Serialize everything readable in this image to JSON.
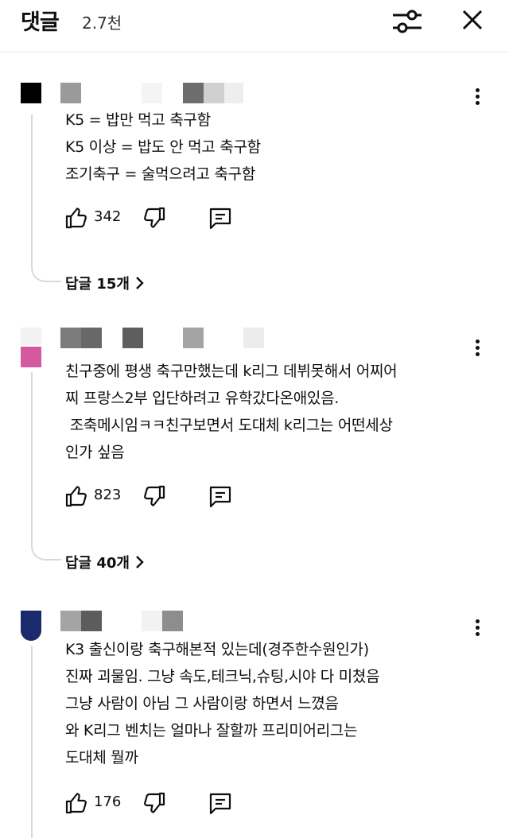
{
  "header": {
    "title": "댓글",
    "count": "2.7천",
    "filter_icon": "sliders-icon",
    "close_icon": "close-icon"
  },
  "comments": [
    {
      "avatar_color": "#000000",
      "lines": [
        "K5 = 밥만 먹고 축구함",
        "K5 이상 = 밥도 안 먹고 축구함",
        "조기축구 = 술먹으려고 축구함"
      ],
      "likes": "342",
      "replies": "답글 15개"
    },
    {
      "avatar_color": "#d4599f",
      "lines": [
        "친구중에 평생 축구만했는데 k리그 데뷔못해서 어찌어",
        "찌 프랑스2부 입단하려고 유학갔다온애있음.",
        " 조축메시임ㅋㅋ친구보면서 도대체 k리그는 어떤세상",
        "인가 싶음"
      ],
      "likes": "823",
      "replies": "답글 40개"
    },
    {
      "avatar_color": "#1a2a6c",
      "lines": [
        "K3 출신이랑 축구해본적 있는데(경주한수원인가)",
        "진짜 괴물임. 그냥 속도,테크닉,슈팅,시야 다 미쳤음",
        "그냥 사람이 아님 그 사람이랑 하면서 느꼈음",
        "와 K리그 벤치는 얼마나 잘할까 프리미어리그는",
        "도대체 뭘까"
      ],
      "likes": "176"
    }
  ],
  "icons": {
    "like": "thumbs-up-icon",
    "dislike": "thumbs-down-icon",
    "reply": "reply-comment-icon",
    "more": "more-vertical-icon",
    "chevron": "chevron-right-icon"
  }
}
